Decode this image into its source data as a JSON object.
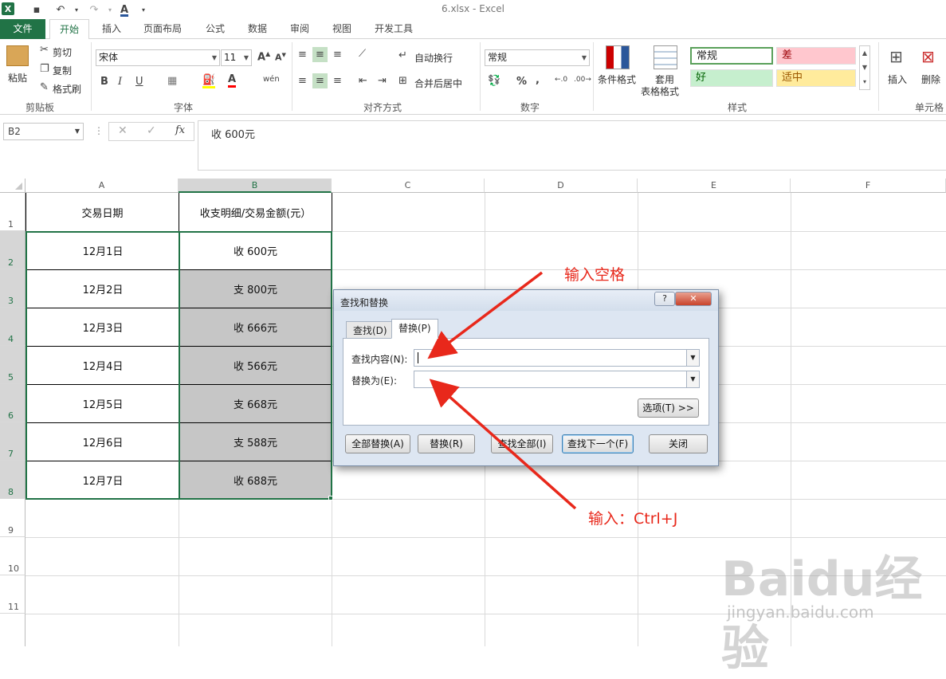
{
  "window": {
    "title": "6.xlsx - Excel",
    "logo": "X"
  },
  "quick_access": {
    "save_icon": "save-icon",
    "undo_icon": "undo-icon",
    "redo_icon": "redo-icon",
    "font_color_glyph": "A"
  },
  "tabs": [
    "文件",
    "开始",
    "插入",
    "页面布局",
    "公式",
    "数据",
    "审阅",
    "视图",
    "开发工具"
  ],
  "ribbon": {
    "clipboard": {
      "paste": "粘贴",
      "cut": "剪切",
      "copy": "复制",
      "format_painter": "格式刷",
      "label": "剪贴板"
    },
    "font": {
      "name": "宋体",
      "size": "11",
      "bold": "B",
      "italic": "I",
      "underline": "U",
      "wen": "wén",
      "label": "字体"
    },
    "alignment": {
      "wrap": "自动换行",
      "merge": "合并后居中",
      "label": "对齐方式"
    },
    "number": {
      "format": "常规",
      "percent": "%",
      "comma": ",",
      "label": "数字"
    },
    "styles": {
      "conditional": "条件格式",
      "table_format_1": "套用",
      "table_format_2": "表格格式",
      "normal": "常规",
      "bad": "差",
      "good": "好",
      "neutral": "适中",
      "label": "样式"
    },
    "cells": {
      "insert": "插入",
      "delete": "删除",
      "label": "单元格"
    }
  },
  "formula_bar": {
    "name_box": "B2",
    "cancel": "✕",
    "enter": "✓",
    "fx": "fx",
    "content": "收 600元"
  },
  "sheet": {
    "columns": [
      "A",
      "B",
      "C",
      "D",
      "E",
      "F"
    ],
    "rows": [
      "1",
      "2",
      "3",
      "4",
      "5",
      "6",
      "7",
      "8",
      "9",
      "10",
      "11"
    ],
    "header_a": "交易日期",
    "header_b": "收支明细/交易金额(元）",
    "dates": [
      "12月1日",
      "12月2日",
      "12月3日",
      "12月4日",
      "12月5日",
      "12月6日",
      "12月7日"
    ],
    "amounts": [
      "收 600元",
      "支 800元",
      "收 666元",
      "收 566元",
      "支 668元",
      "支 588元",
      "收 688元"
    ]
  },
  "dialog": {
    "title": "查找和替换",
    "help": "?",
    "close_glyph": "✕",
    "tab_find": "查找(D)",
    "tab_replace": "替换(P)",
    "find_label": "查找内容(N):",
    "replace_label": "替换为(E):",
    "find_value": "",
    "replace_value": "",
    "options": "选项(T) >>",
    "replace_all": "全部替换(A)",
    "replace": "替换(R)",
    "find_all": "查找全部(I)",
    "find_next": "查找下一个(F)",
    "close": "关闭"
  },
  "annotations": {
    "top": "输入空格",
    "bottom": "输入：Ctrl+J",
    "color": "#e8281b"
  },
  "watermark": {
    "brand": "Baidu经验",
    "url": "jingyan.baidu.com"
  }
}
